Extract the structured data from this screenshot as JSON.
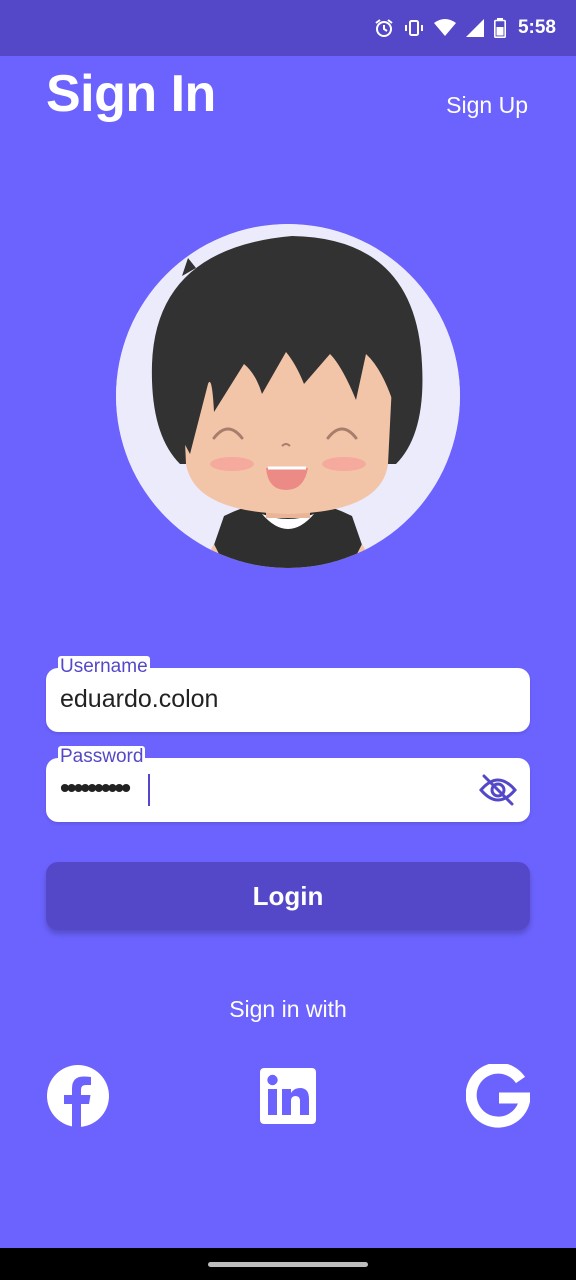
{
  "status_bar": {
    "time": "5:58",
    "icons": [
      "alarm-icon",
      "vibrate-icon",
      "wifi-icon",
      "signal-icon",
      "battery-icon"
    ]
  },
  "header": {
    "title": "Sign In",
    "signup_label": "Sign Up"
  },
  "form": {
    "username": {
      "label": "Username",
      "value": "eduardo.colon"
    },
    "password": {
      "label": "Password",
      "value": "••••••••••",
      "visibility_icon": "eye-off-icon"
    },
    "login_label": "Login"
  },
  "social": {
    "heading": "Sign in with",
    "providers": [
      "facebook-icon",
      "linkedin-icon",
      "google-icon"
    ]
  },
  "colors": {
    "background": "#6c63ff",
    "accent": "#5448c8",
    "avatar_bg": "#ecebfb"
  }
}
